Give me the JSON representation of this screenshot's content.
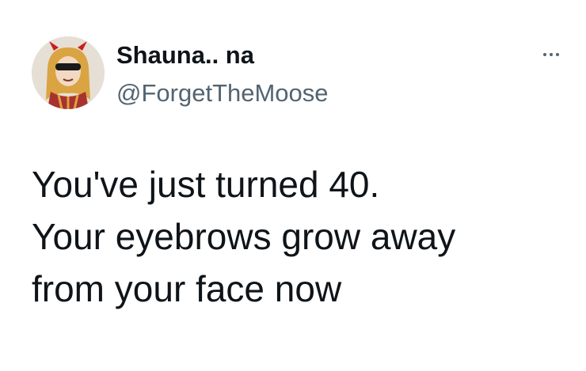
{
  "author": {
    "display_name": "Shauna.. na",
    "handle": "@ForgetTheMoose",
    "avatar_icon": "profile-avatar"
  },
  "actions": {
    "more_icon": "more-options-icon"
  },
  "tweet": {
    "lines": [
      "You've just turned 40.",
      "Your eyebrows grow away",
      "from your face now"
    ]
  },
  "colors": {
    "text_primary": "#0f1419",
    "text_secondary": "#536471",
    "background": "#ffffff"
  }
}
